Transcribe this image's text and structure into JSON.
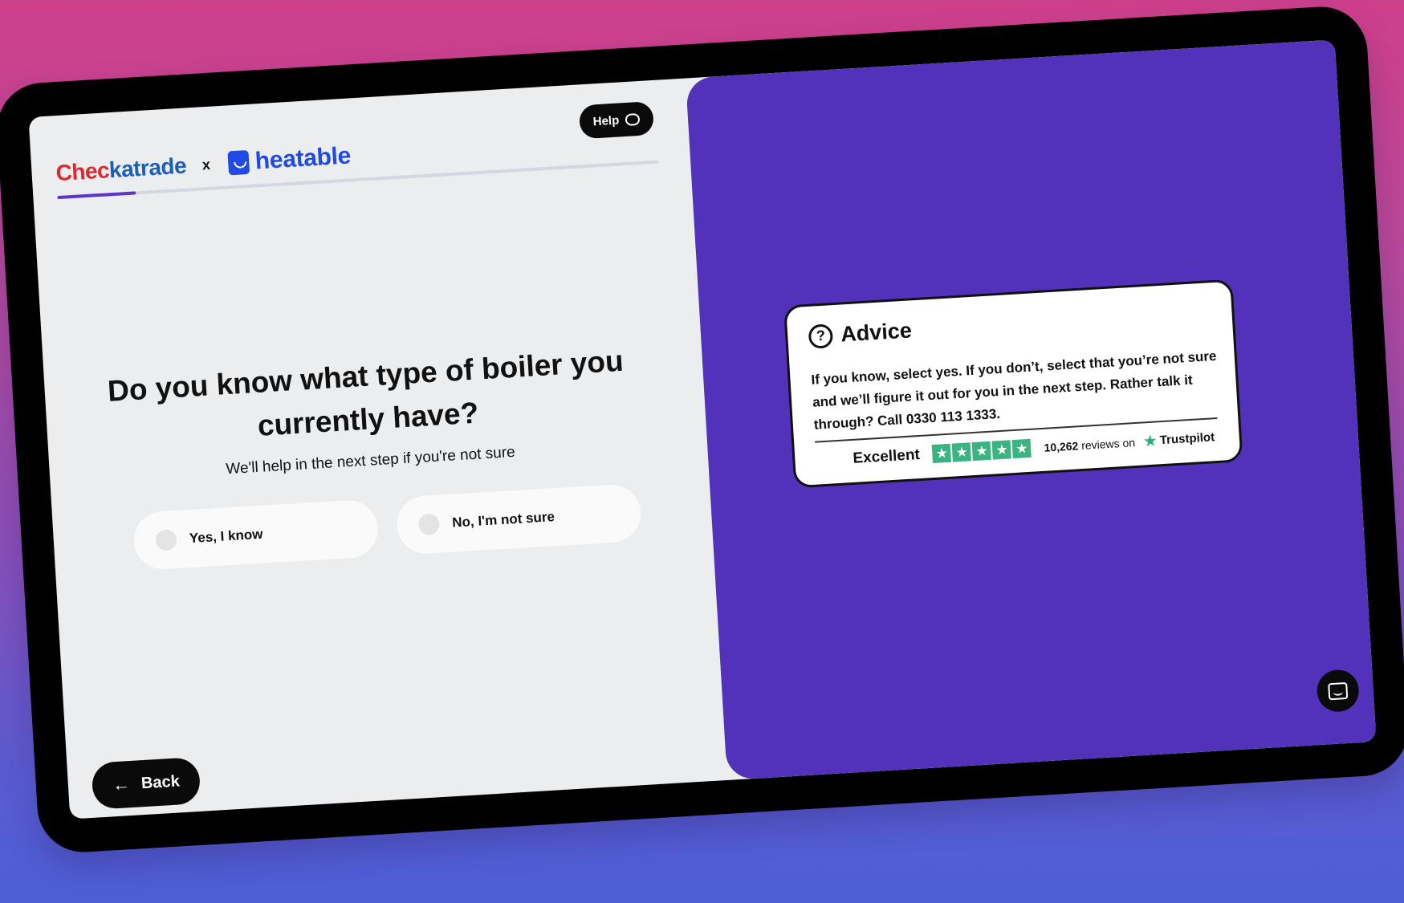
{
  "brand": {
    "checkatrade_part1": "Chec",
    "checkatrade_part2": "katrade",
    "separator": "x",
    "heatable": "heatable",
    "checkatrade_color_red": "#e3262e",
    "checkatrade_color_blue": "#1d5fb6",
    "heatable_color": "#2049e6"
  },
  "header": {
    "help_label": "Help",
    "help_icon": "chat-bubble-icon"
  },
  "progress": {
    "fraction": 0.13,
    "color": "#5a36c9"
  },
  "question": {
    "title": "Do you know what type of boiler you currently have?",
    "subtitle": "We'll help in the next step if you're not sure"
  },
  "options": [
    {
      "label": "Yes, I know"
    },
    {
      "label": "No, I'm not sure"
    }
  ],
  "footer": {
    "back_label": "Back",
    "back_icon": "arrow-left-icon"
  },
  "advice": {
    "icon": "question-circle-icon",
    "title": "Advice",
    "body": "If you know, select yes. If you don’t, select that you’re not sure and we’ll figure it out for you in the next step. Rather talk it through? Call 0330 113 1333.",
    "rating_label": "Excellent",
    "stars": 5,
    "review_count": "10,262",
    "reviews_text": "reviews on",
    "trustpilot": "Trustpilot",
    "star_color": "#3cb383"
  },
  "colors": {
    "right_panel": "#5232bb",
    "page_background": "#ecedef"
  },
  "messenger": {
    "icon": "messenger-icon"
  }
}
